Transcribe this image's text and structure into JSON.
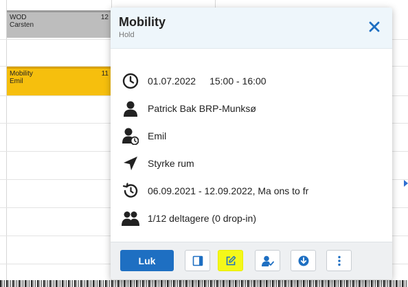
{
  "calendar": {
    "events": [
      {
        "title": "WOD",
        "subtitle": "Carsten",
        "count": "12",
        "color": "#bdbdbd"
      },
      {
        "title": "Mobility",
        "subtitle": "Emil",
        "count": "11",
        "color": "#f6bf0d"
      }
    ]
  },
  "popup": {
    "title": "Mobility",
    "subtitle": "Hold",
    "close_icon": "close-icon",
    "details": {
      "date": "01.07.2022",
      "time": "15:00 - 16:00",
      "coach": "Patrick Bak BRP-Munksø",
      "substitute": "Emil",
      "location": "Styrke rum",
      "recurrence": "06.09.2021 - 12.09.2022, Ma ons to fr",
      "participants": "1/12 deltagere (0 drop-in)"
    },
    "footer": {
      "close_label": "Luk",
      "buttons": [
        "sidebar-panel-icon",
        "edit-icon",
        "add-person-icon",
        "download-icon",
        "more-vertical-icon"
      ],
      "highlight_color": "#f4f81a"
    }
  },
  "colors": {
    "accent": "#1e6fc2",
    "header_bg": "#eef6fb"
  }
}
